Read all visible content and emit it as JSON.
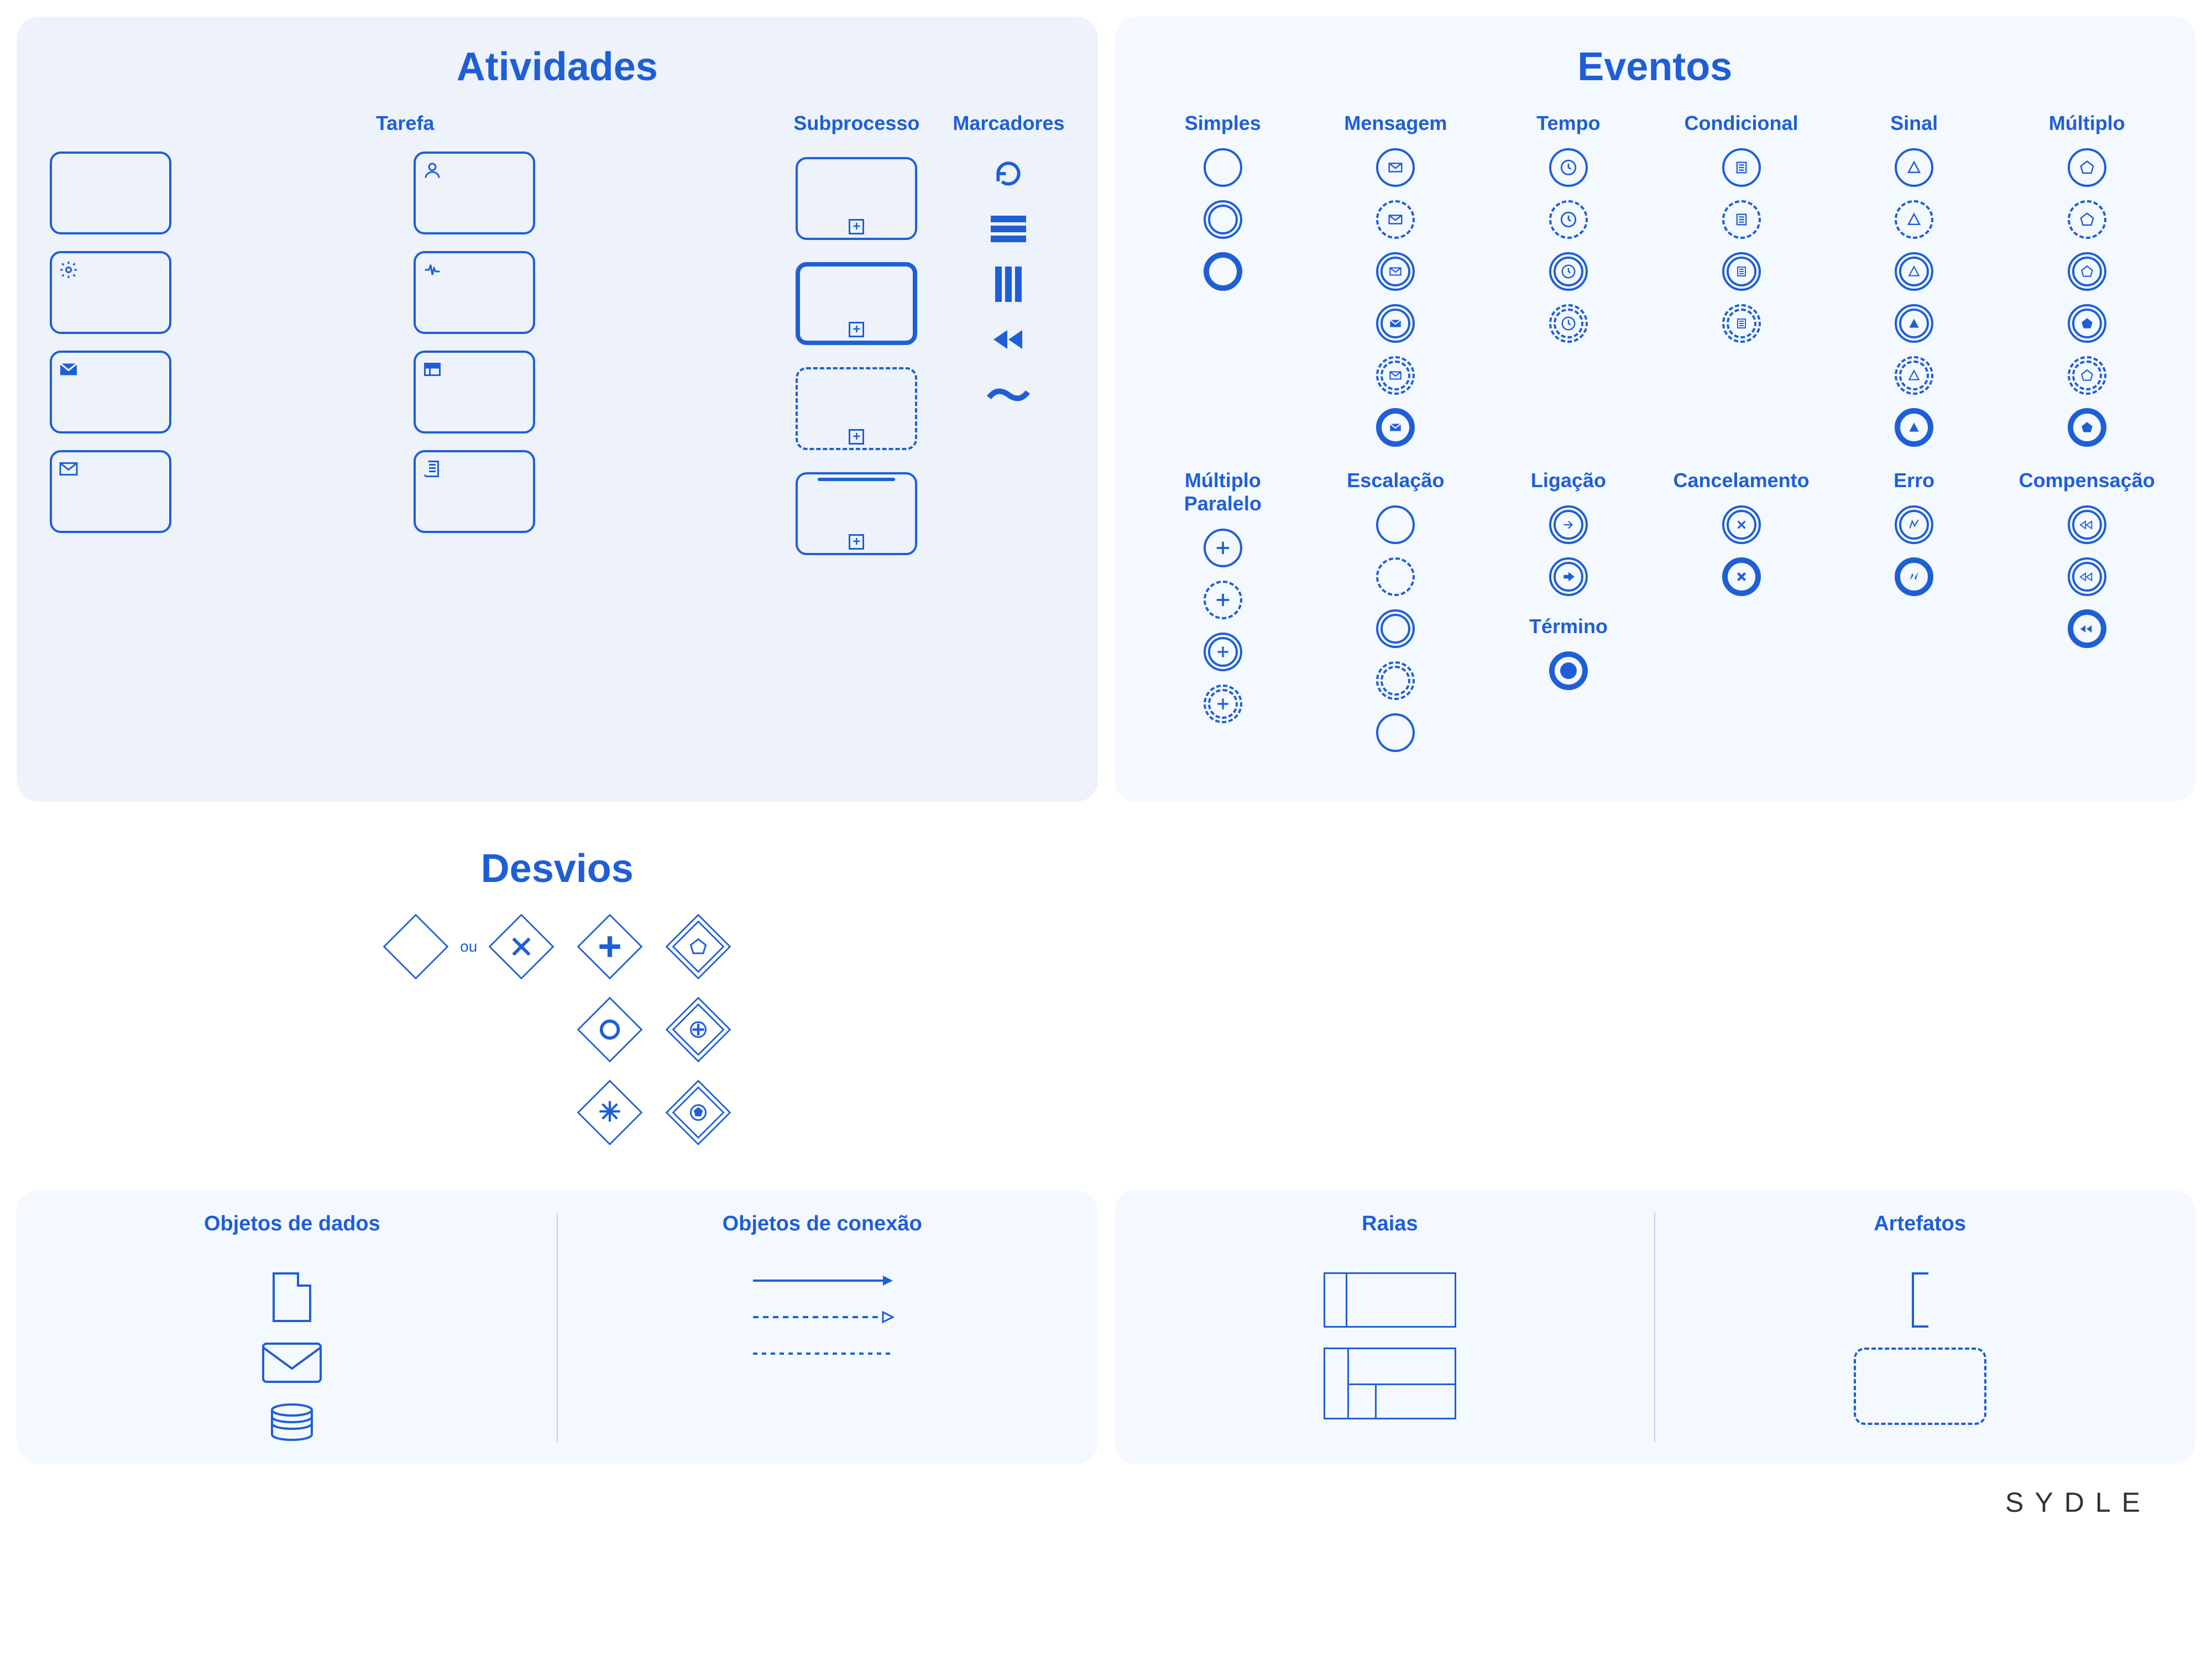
{
  "brand": "SYDLE",
  "panels": {
    "activities": {
      "title": "Atividades",
      "cols": {
        "task": "Tarefa",
        "subprocess": "Subprocesso",
        "markers": "Marcadores"
      }
    },
    "events": {
      "title": "Eventos",
      "set1": [
        "Simples",
        "Mensagem",
        "Tempo",
        "Condicional",
        "Sinal",
        "Múltiplo"
      ],
      "set2": [
        "Múltiplo Paralelo",
        "Escalação",
        "Ligação",
        "Cancelamento",
        "Erro",
        "Compensação"
      ],
      "termino": "Término"
    },
    "gateways": {
      "title": "Desvios",
      "ou": "ou"
    },
    "dataobjects": "Objetos de dados",
    "connections": "Objetos de conexão",
    "lanes": "Raias",
    "artifacts": "Artefatos"
  }
}
